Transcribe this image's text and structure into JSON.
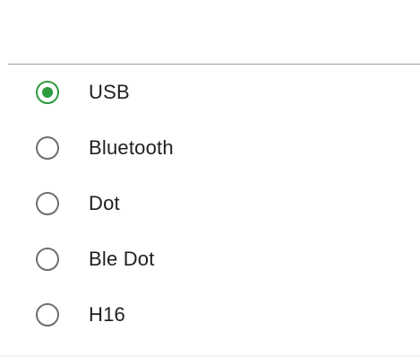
{
  "colors": {
    "accent": "#2e9b3f",
    "radio_border": "#6f6f6f",
    "divider": "#9e9e9e",
    "text": "#1f1f1f"
  },
  "options": [
    {
      "label": "USB",
      "selected": true
    },
    {
      "label": "Bluetooth",
      "selected": false
    },
    {
      "label": "Dot",
      "selected": false
    },
    {
      "label": "Ble Dot",
      "selected": false
    },
    {
      "label": "H16",
      "selected": false
    }
  ]
}
